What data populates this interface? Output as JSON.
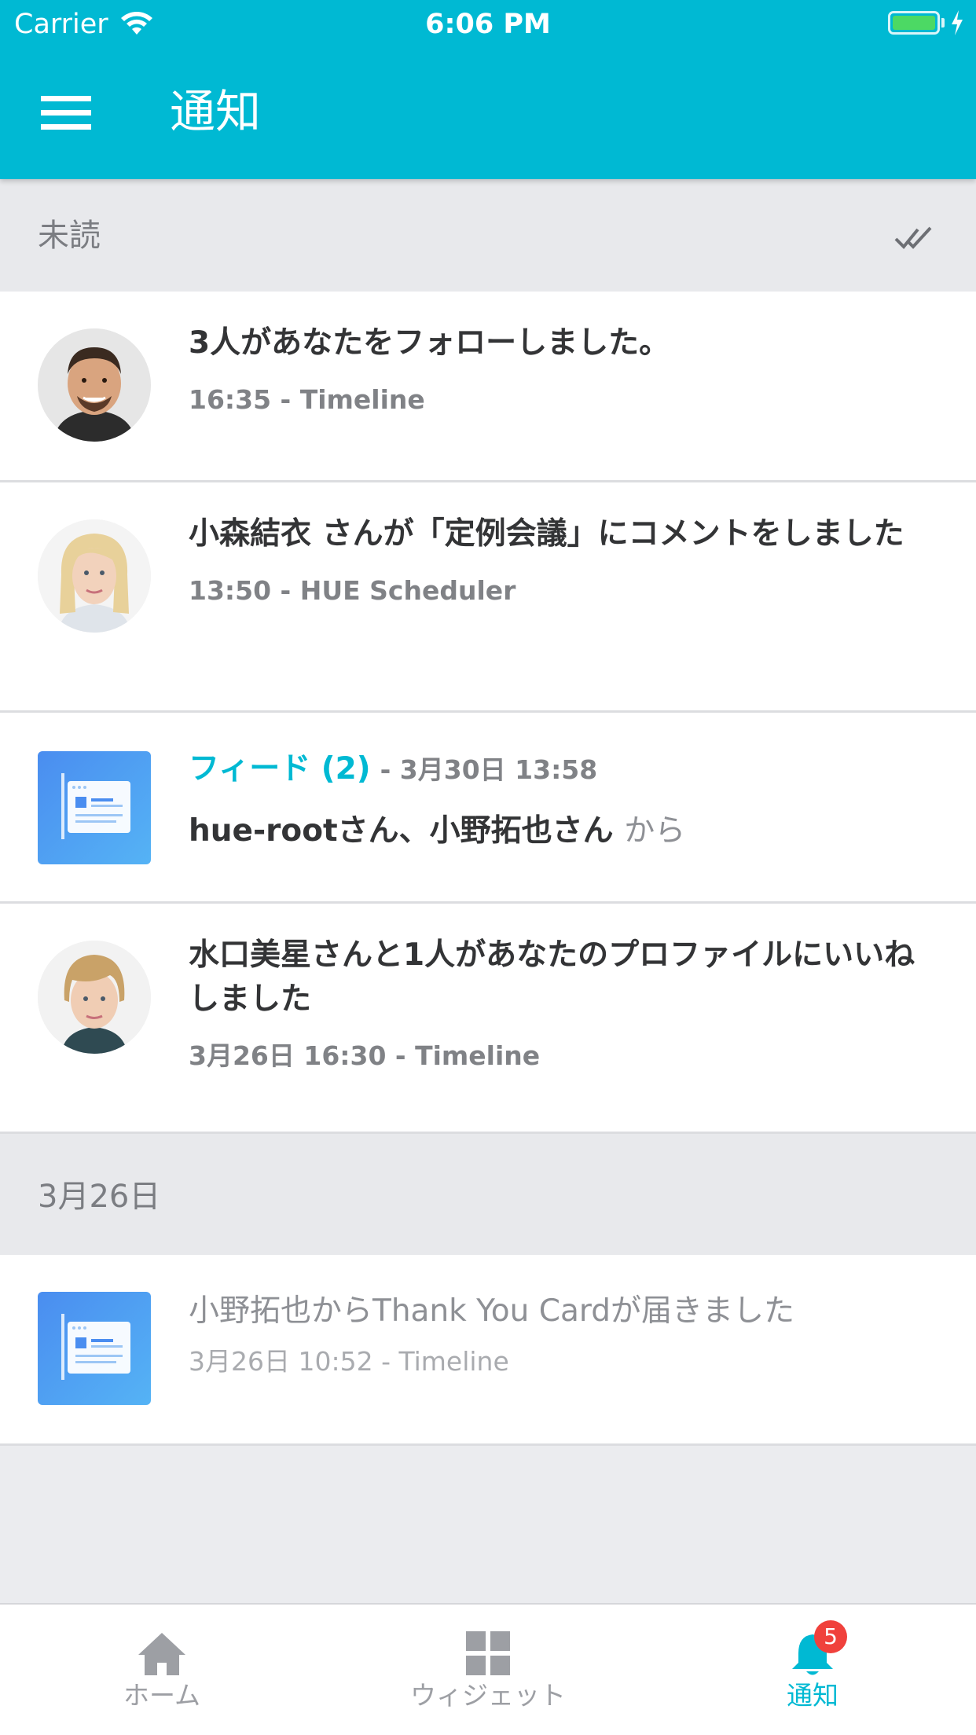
{
  "status_bar": {
    "carrier": "Carrier",
    "time": "6:06 PM"
  },
  "header": {
    "title": "通知"
  },
  "sections": {
    "unread": {
      "title": "未読",
      "items": [
        {
          "avatar": "man-smiling-photo",
          "title": "3人があなたをフォローしました。",
          "meta": "16:35 - Timeline"
        },
        {
          "avatar": "blonde-woman-photo",
          "title": "小森結衣 さんが「定例会議」にコメントをしました",
          "meta": "13:50 - HUE Scheduler"
        },
        {
          "icon": "feed-app-icon",
          "feed_label": "フィード (2)",
          "feed_meta": "- 3月30日 13:58",
          "feed_names": "hue-rootさん、小野拓也さん",
          "feed_from": "から"
        },
        {
          "avatar": "woman-short-hair-photo",
          "title": "水口美星さんと1人があなたのプロファイルにいいねしました",
          "meta": "3月26日 16:30 - Timeline"
        }
      ]
    },
    "date_group": {
      "title": "3月26日",
      "items": [
        {
          "icon": "feed-app-icon",
          "title": "小野拓也からThank You Cardが届きました",
          "meta": "3月26日 10:52 - Timeline"
        }
      ]
    }
  },
  "tabbar": {
    "home": "ホーム",
    "widget": "ウィジェット",
    "notifications": "通知",
    "badge_count": "5"
  },
  "colors": {
    "accent": "#00b9d3",
    "badge": "#f0413c",
    "battery": "#4cd964"
  }
}
